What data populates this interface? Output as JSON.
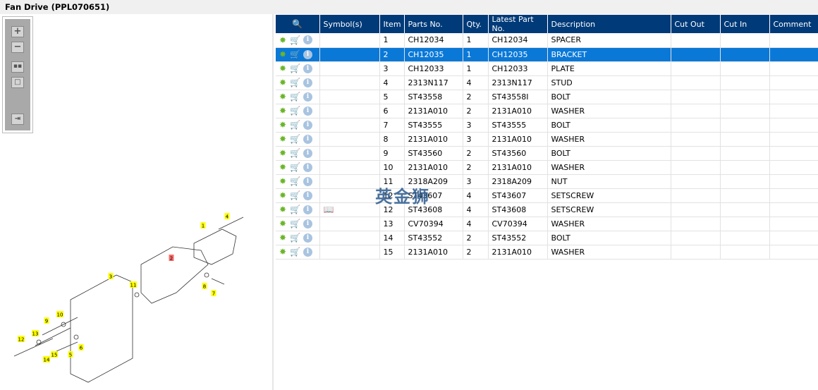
{
  "title": "Fan Drive (PPL070651)",
  "toolbar": {
    "zoom_in": "+",
    "zoom_out": "−"
  },
  "columns": [
    "",
    "Symbol(s)",
    "Item",
    "Parts No.",
    "Qty.",
    "Latest Part No.",
    "Description",
    "Cut Out",
    "Cut In",
    "Comment"
  ],
  "rows": [
    {
      "item": "1",
      "part": "CH12034",
      "qty": "1",
      "latest": "CH12034",
      "desc": "SPACER",
      "symbol": ""
    },
    {
      "item": "2",
      "part": "CH12035",
      "qty": "1",
      "latest": "CH12035",
      "desc": "BRACKET",
      "symbol": "",
      "selected": true
    },
    {
      "item": "3",
      "part": "CH12033",
      "qty": "1",
      "latest": "CH12033",
      "desc": "PLATE",
      "symbol": ""
    },
    {
      "item": "4",
      "part": "2313N117",
      "qty": "4",
      "latest": "2313N117",
      "desc": "STUD",
      "symbol": ""
    },
    {
      "item": "5",
      "part": "ST43558",
      "qty": "2",
      "latest": "ST43558I",
      "desc": "BOLT",
      "symbol": ""
    },
    {
      "item": "6",
      "part": "2131A010",
      "qty": "2",
      "latest": "2131A010",
      "desc": "WASHER",
      "symbol": ""
    },
    {
      "item": "7",
      "part": "ST43555",
      "qty": "3",
      "latest": "ST43555",
      "desc": "BOLT",
      "symbol": ""
    },
    {
      "item": "8",
      "part": "2131A010",
      "qty": "3",
      "latest": "2131A010",
      "desc": "WASHER",
      "symbol": ""
    },
    {
      "item": "9",
      "part": "ST43560",
      "qty": "2",
      "latest": "ST43560",
      "desc": "BOLT",
      "symbol": ""
    },
    {
      "item": "10",
      "part": "2131A010",
      "qty": "2",
      "latest": "2131A010",
      "desc": "WASHER",
      "symbol": ""
    },
    {
      "item": "11",
      "part": "2318A209",
      "qty": "3",
      "latest": "2318A209",
      "desc": "NUT",
      "symbol": ""
    },
    {
      "item": "12",
      "part": "ST43607",
      "qty": "4",
      "latest": "ST43607",
      "desc": "SETSCREW",
      "symbol": ""
    },
    {
      "item": "12",
      "part": "ST43608",
      "qty": "4",
      "latest": "ST43608",
      "desc": "SETSCREW",
      "symbol": "book"
    },
    {
      "item": "13",
      "part": "CV70394",
      "qty": "4",
      "latest": "CV70394",
      "desc": "WASHER",
      "symbol": ""
    },
    {
      "item": "14",
      "part": "ST43552",
      "qty": "2",
      "latest": "ST43552",
      "desc": "BOLT",
      "symbol": ""
    },
    {
      "item": "15",
      "part": "2131A010",
      "qty": "2",
      "latest": "2131A010",
      "desc": "WASHER",
      "symbol": ""
    }
  ],
  "callouts": [
    {
      "n": "1"
    },
    {
      "n": "4"
    },
    {
      "n": "2",
      "selected": true
    },
    {
      "n": "3"
    },
    {
      "n": "11"
    },
    {
      "n": "8"
    },
    {
      "n": "7"
    },
    {
      "n": "10"
    },
    {
      "n": "9"
    },
    {
      "n": "13"
    },
    {
      "n": "12"
    },
    {
      "n": "6"
    },
    {
      "n": "15"
    },
    {
      "n": "5"
    },
    {
      "n": "14"
    }
  ],
  "watermark": "英金狮",
  "colors": {
    "header": "#003a78",
    "selected": "#0a78d7",
    "callout": "#ffff00",
    "callout_selected": "#ff6b6b"
  }
}
